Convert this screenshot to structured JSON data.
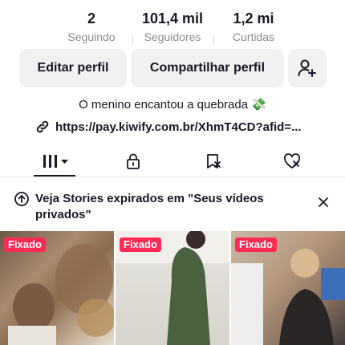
{
  "stats": [
    {
      "value": "2",
      "label": "Seguindo"
    },
    {
      "value": "101,4 mil",
      "label": "Seguidores"
    },
    {
      "value": "1,2 mi",
      "label": "Curtidas"
    }
  ],
  "buttons": {
    "edit_profile": "Editar perfil",
    "share_profile": "Compartilhar perfil"
  },
  "bio": "O menino encantou a quebrada 💸",
  "link": "https://pay.kiwify.com.br/XhmT4CD?afid=...",
  "tabs": [
    "videos-grid-icon",
    "lock-icon",
    "bookmark-icon",
    "heart-icon"
  ],
  "notice": {
    "text": "Veja Stories expirados em \"Seus vídeos privados\""
  },
  "videos": [
    {
      "badge": "Fixado"
    },
    {
      "badge": "Fixado"
    },
    {
      "badge": "Fixado"
    }
  ],
  "colors": {
    "accent": "#fe2c55",
    "text": "#161823",
    "muted": "#8a8b91",
    "button_bg": "#f1f1f2"
  }
}
